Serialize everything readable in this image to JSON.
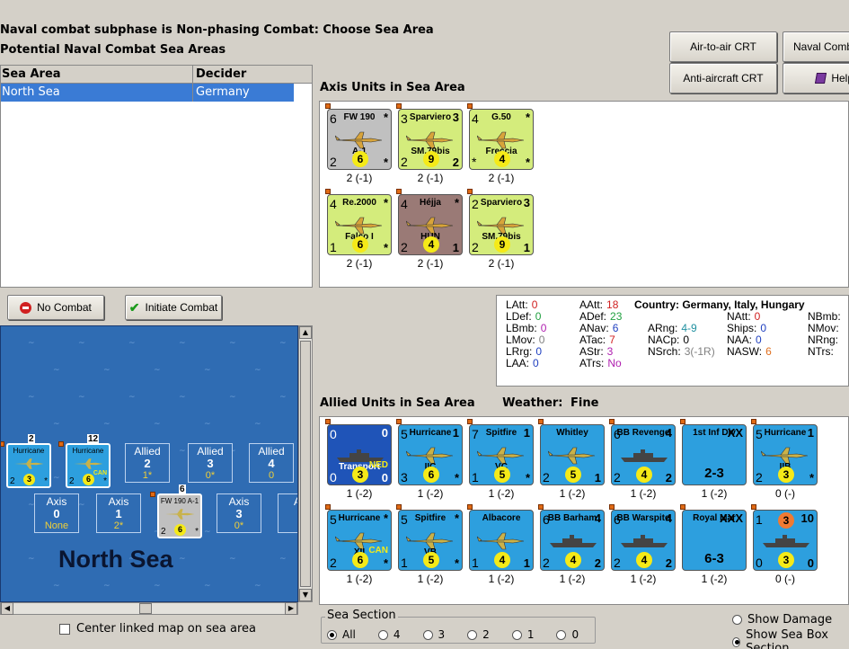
{
  "header": {
    "phase": "Naval combat subphase is Non-phasing Combat: Choose Sea Area",
    "subtitle": "Potential Naval Combat Sea Areas"
  },
  "buttons": {
    "air_to_air": "Air-to-air CRT",
    "naval_combat": "Naval Combat",
    "anti_aircraft": "Anti-aircraft CRT",
    "help": "Help",
    "no_combat": "No Combat",
    "initiate_combat": "Initiate Combat"
  },
  "sea_table": {
    "headers": [
      "Sea Area",
      "Decider"
    ],
    "rows": [
      {
        "area": "North Sea",
        "decider": "Germany"
      }
    ]
  },
  "axis_panel": {
    "label": "Axis Units in Sea Area",
    "units": [
      {
        "name": "FW 190",
        "name2": "A-1",
        "tl": "6",
        "tr": "*",
        "bl": "2",
        "circle": "6",
        "br": "*",
        "cap": "2 (-1)"
      },
      {
        "name": "Sparviero",
        "name2": "SM.79bis",
        "tl": "3",
        "tr": "3",
        "bl": "2",
        "circle": "9",
        "br": "2",
        "cap": "2 (-1)"
      },
      {
        "name": "G.50",
        "name2": "Freccia",
        "tl": "4",
        "tr": "*",
        "bl": "*",
        "circle": "4",
        "br": "*",
        "cap": "2 (-1)"
      },
      {
        "name": "Re.2000",
        "name2": "Falco I",
        "tl": "4",
        "tr": "*",
        "bl": "1",
        "circle": "6",
        "br": "*",
        "cap": "2 (-1)"
      },
      {
        "name": "Héjja",
        "name2": "HUN",
        "tl": "4",
        "tr": "*",
        "bl": "2",
        "circle": "4",
        "br": "1",
        "cap": "2 (-1)"
      },
      {
        "name": "Sparviero",
        "name2": "SM.79bis",
        "tl": "2",
        "tr": "3",
        "bl": "2",
        "circle": "9",
        "br": "1",
        "cap": "2 (-1)"
      }
    ]
  },
  "stats": {
    "country_label": "Country:",
    "country": "Germany, Italy, Hungary",
    "rows": [
      {
        "k": "LAtt:",
        "v": "0",
        "color": "#d02020"
      },
      {
        "k": "LDef:",
        "v": "0",
        "color": "#20a040"
      },
      {
        "k": "LBmb:",
        "v": "0",
        "color": "#b020b0"
      },
      {
        "k": "LMov:",
        "v": "0",
        "color": "#808080"
      },
      {
        "k": "LRrg:",
        "v": "0",
        "color": "#2040c0"
      },
      {
        "k": "LAA:",
        "v": "0",
        "color": "#2040c0"
      },
      {
        "k": "AAtt:",
        "v": "18",
        "color": "#d02020"
      },
      {
        "k": "ADef:",
        "v": "23",
        "color": "#20a040"
      },
      {
        "k": "ANav:",
        "v": "6",
        "color": "#2040c0"
      },
      {
        "k": "ATac:",
        "v": "7",
        "color": "#d02020"
      },
      {
        "k": "AStr:",
        "v": "3",
        "color": "#b020b0"
      },
      {
        "k": "ATrs:",
        "v": "No",
        "color": "#b020b0"
      },
      {
        "k": "ARng:",
        "v": "4-9",
        "color": "#2090a0"
      },
      {
        "k": "NACp:",
        "v": "0",
        "color": "#000000"
      },
      {
        "k": "NSrch:",
        "v": "3(-1R)",
        "color": "#808080"
      },
      {
        "k": "NAtt:",
        "v": "0",
        "color": "#d02020"
      },
      {
        "k": "Ships:",
        "v": "0",
        "color": "#2040c0"
      },
      {
        "k": "NAA:",
        "v": "0",
        "color": "#2040c0"
      },
      {
        "k": "NASW:",
        "v": "6",
        "color": "#e07020"
      },
      {
        "k": "NBmb:",
        "v": "",
        "color": "#000000"
      },
      {
        "k": "NMov:",
        "v": "",
        "color": "#000000"
      },
      {
        "k": "NRng:",
        "v": "",
        "color": "#000000"
      },
      {
        "k": "NTrs:",
        "v": "",
        "color": "#000000"
      }
    ]
  },
  "allied_panel": {
    "label": "Allied Units in Sea Area",
    "weather_label": "Weather:",
    "weather": "Fine",
    "units": [
      {
        "name": "",
        "name2": "Transport",
        "tl": "0",
        "tr": "0",
        "bl": "0",
        "circle": "3",
        "br": "0",
        "cap": "1 (-2)",
        "tag": "NED"
      },
      {
        "name": "Hurricane",
        "name2": "IIC",
        "tl": "5",
        "tr": "1",
        "bl": "3",
        "circle": "6",
        "br": "*",
        "cap": "1 (-2)"
      },
      {
        "name": "Spitfire",
        "name2": "VC",
        "tl": "7",
        "tr": "1",
        "bl": "1",
        "circle": "5",
        "br": "*",
        "cap": "1 (-2)"
      },
      {
        "name": "Whitley",
        "name2": "",
        "tl": "",
        "tr": "",
        "bl": "2",
        "circle": "5",
        "br": "1",
        "cap": "1 (-2)"
      },
      {
        "name": "BB Revenge",
        "name2": "",
        "tl": "6",
        "tr": "4",
        "bl": "2",
        "circle": "4",
        "br": "2",
        "cap": "1 (-2)"
      },
      {
        "name": "1st Inf Div",
        "name2": "2-3",
        "tl": "",
        "tr": "XX",
        "bl": "",
        "circle": "",
        "br": "",
        "cap": "1 (-2)"
      },
      {
        "name": "Hurricane",
        "name2": "IIB",
        "tl": "5",
        "tr": "1",
        "bl": "2",
        "circle": "3",
        "br": "*",
        "cap": "0 (-)"
      },
      {
        "name": "Hurricane",
        "name2": "XII",
        "tl": "5",
        "tr": "*",
        "bl": "2",
        "circle": "6",
        "br": "*",
        "cap": "1 (-2)",
        "tag": "CAN"
      },
      {
        "name": "Spitfire",
        "name2": "VB",
        "tl": "5",
        "tr": "*",
        "bl": "1",
        "circle": "5",
        "br": "*",
        "cap": "1 (-2)"
      },
      {
        "name": "Albacore",
        "name2": "",
        "tl": "",
        "tr": "",
        "bl": "1",
        "circle": "4",
        "br": "1",
        "cap": "1 (-2)"
      },
      {
        "name": "BB Barham",
        "name2": "",
        "tl": "6",
        "tr": "4",
        "bl": "2",
        "circle": "4",
        "br": "2",
        "cap": "1 (-2)"
      },
      {
        "name": "BB Warspite",
        "name2": "",
        "tl": "6",
        "tr": "4",
        "bl": "2",
        "circle": "4",
        "br": "2",
        "cap": "1 (-2)"
      },
      {
        "name": "Royal Mar",
        "name2": "6-3",
        "tl": "",
        "tr": "XXX",
        "bl": "",
        "circle": "",
        "br": "",
        "cap": "1 (-2)"
      },
      {
        "name": "",
        "name2": "",
        "tl": "1",
        "tr": "10",
        "bl": "0",
        "circle": "3",
        "br": "0",
        "cap": "0 (-)",
        "top_circle": "3"
      }
    ]
  },
  "map": {
    "sea_name": "North Sea",
    "allied_boxes": [
      {
        "label": "Allied",
        "value": "2",
        "sub": "1*"
      },
      {
        "label": "Allied",
        "value": "3",
        "sub": "0*"
      },
      {
        "label": "Allied",
        "value": "4",
        "sub": "0"
      }
    ],
    "axis_boxes": [
      {
        "label": "Axis",
        "value": "0",
        "sub": "None"
      },
      {
        "label": "Axis",
        "value": "1",
        "sub": "2*"
      },
      {
        "label": "Axis",
        "value": "3",
        "sub": "0*"
      },
      {
        "label": "Ax",
        "value": "",
        "sub": ""
      }
    ],
    "counters": [
      {
        "name": "Hurricane",
        "count": "2",
        "bl": "2",
        "circle": "3",
        "br": "*"
      },
      {
        "name": "Hurricane",
        "count": "12",
        "bl": "2",
        "circle": "6",
        "br": "*",
        "tag": "CAN"
      },
      {
        "name": "FW 190 A-1",
        "count": "6",
        "bl": "2",
        "circle": "6",
        "br": "*"
      }
    ],
    "center_checkbox_label": "Center linked map on sea area"
  },
  "sea_section": {
    "label": "Sea Section",
    "options": [
      "All",
      "4",
      "3",
      "2",
      "1",
      "0"
    ],
    "selected": "All"
  },
  "display_options": {
    "show_damage": "Show Damage",
    "show_sea_box": "Show Sea Box Section"
  }
}
